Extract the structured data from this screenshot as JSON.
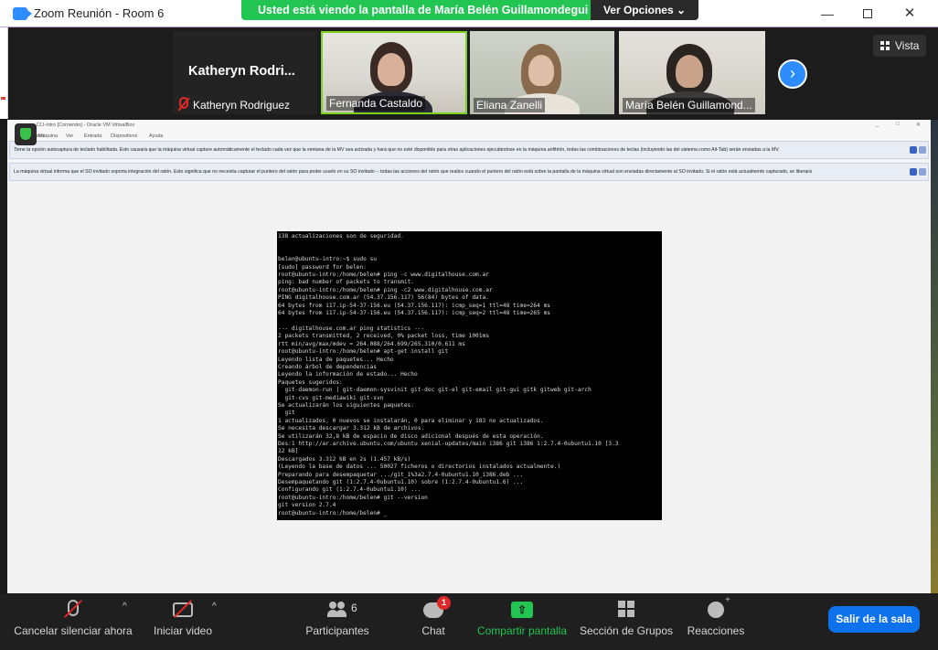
{
  "window": {
    "title": "Zoom Reunión - Room 6",
    "minimize": "—",
    "close": "✕"
  },
  "share_banner": {
    "message": "Usted está viendo la pantalla de María Belén Guillamondegui",
    "options_label": "Ver Opciones ⌄"
  },
  "video_strip": {
    "participants": [
      {
        "name": "Katheryn Rodriguez",
        "display_big": "Katheryn Rodri...",
        "muted": true
      },
      {
        "name": "Fernanda Castaldo",
        "active_speaker": true
      },
      {
        "name": "Eliana Zanelli"
      },
      {
        "name": "María Belén Guillamond..."
      }
    ],
    "next_icon": "›",
    "view_label": "Vista"
  },
  "virtualbox": {
    "title": "CLI-intro [Corriendo] - Oracle VM VirtualBox",
    "menu": [
      "Archivo",
      "Máquina",
      "Ver",
      "Entrada",
      "Dispositivos",
      "Ayuda"
    ],
    "notice_keyboard": "Tiene la opción autocaptura de teclado habilitada. Esto causará que la máquina virtual capture automáticamente el teclado cada vez que la ventana de la MV sea activada y hará que no esté disponible para otras aplicaciones ejecutándose en la máquina anfitrión, todas las combinaciones de teclas (incluyendo las del sistema como Alt-Tab) serán enviadas a la MV.",
    "notice_mouse": "La máquina virtual informa que el SO invitado soporta integración del ratón. Esto significa que no necesita capturar el puntero del ratón para poder usarlo en su SO invitado -- todas las acciones del ratón que realice cuando el puntero del ratón está sobre la pantalla de la máquina virtual son enviadas directamente al SO invitado. Si el ratón está actualmente capturado, se liberará"
  },
  "terminal": {
    "lines": [
      "138 actualizaciones son de seguridad.",
      "",
      "",
      "belen@ubuntu-intro:~$ sudo su",
      "[sudo] password for belen:",
      "root@ubuntu-intro:/home/belen# ping -c www.digitalhouse.com.ar",
      "ping: bad number of packets to transmit.",
      "root@ubuntu-intro:/home/belen# ping -c2 www.digitalhouse.com.ar",
      "PING digitalhouse.com.ar (54.37.156.117) 56(84) bytes of data.",
      "64 bytes from 117.ip-54-37-156.eu (54.37.156.117): icmp_seq=1 ttl=48 time=264 ms",
      "64 bytes from 117.ip-54-37-156.eu (54.37.156.117): icmp_seq=2 ttl=48 time=265 ms",
      "",
      "--- digitalhouse.com.ar ping statistics ---",
      "2 packets transmitted, 2 received, 0% packet loss, time 1001ms",
      "rtt min/avg/max/mdev = 264.088/264.699/265.310/0.611 ms",
      "root@ubuntu-intro:/home/belen# apt-get install git",
      "Leyendo lista de paquetes... Hecho",
      "Creando árbol de dependencias",
      "Leyendo la información de estado... Hecho",
      "Paquetes sugeridos:",
      "  git-daemon-run | git-daemon-sysvinit git-doc git-el git-email git-gui gitk gitweb git-arch",
      "  git-cvs git-mediawiki git-svn",
      "Se actualizarán los siguientes paquetes:",
      "  git",
      "1 actualizados, 0 nuevos se instalarán, 0 para eliminar y 183 no actualizados.",
      "Se necesita descargar 3.312 kB de archivos.",
      "Se utilizarán 32,8 kB de espacio de disco adicional después de esta operación.",
      "Des:1 http://ar.archive.ubuntu.com/ubuntu xenial-updates/main i386 git i386 1:2.7.4-0ubuntu1.10 [3.3",
      "12 kB]",
      "Descargados 3.312 kB en 2s (1.457 kB/s)",
      "(Leyendo la base de datos ... 50027 ficheros o directorios instalados actualmente.)",
      "Preparando para desempaquetar .../git_1%3a2.7.4-0ubuntu1.10_i386.deb ...",
      "Desempaquetando git (1:2.7.4-0ubuntu1.10) sobre (1:2.7.4-0ubuntu1.6) ...",
      "Configurando git (1:2.7.4-0ubuntu1.10) ...",
      "root@ubuntu-intro:/home/belen# git --version",
      "git version 2.7.4",
      "root@ubuntu-intro:/home/belen# _"
    ]
  },
  "toolbar": {
    "mute_label": "Cancelar silenciar ahora",
    "video_label": "Iniciar video",
    "participants_label": "Participantes",
    "participants_count": "6",
    "chat_label": "Chat",
    "chat_badge": "1",
    "share_label": "Compartir pantalla",
    "share_arrow": "⇧",
    "groups_label": "Sección de Grupos",
    "reactions_label": "Reacciones",
    "leave_label": "Salir de la sala",
    "caret": "^"
  },
  "colors": {
    "accent_blue": "#0e72ed",
    "share_green": "#23c552",
    "mute_red": "#e02828",
    "active_speaker_border": "#7bd320"
  }
}
